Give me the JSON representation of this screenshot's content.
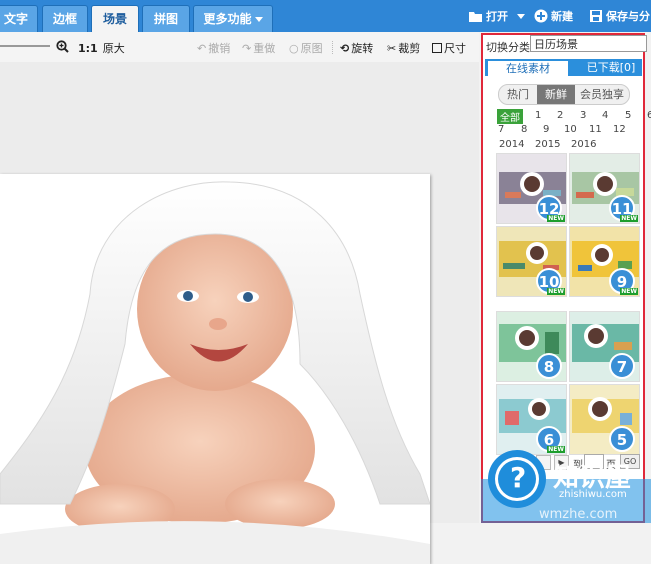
{
  "top_tabs": [
    {
      "label": "文字",
      "active": false
    },
    {
      "label": "边框",
      "active": false
    },
    {
      "label": "场景",
      "active": true
    },
    {
      "label": "拼图",
      "active": false
    },
    {
      "label": "更多功能",
      "active": false
    }
  ],
  "top_actions": {
    "open": "打开",
    "new": "新建",
    "save": "保存与分"
  },
  "toolbar": {
    "ratio": "1:1",
    "original_size": "原大",
    "undo": "撤销",
    "redo": "重做",
    "original": "原图",
    "rotate": "旋转",
    "crop": "裁剪",
    "size": "尺寸"
  },
  "panel": {
    "category_label": "切换分类",
    "category_value": "日历场景",
    "tabs": {
      "online": "在线素材",
      "downloaded": "已下载[0]"
    },
    "filters": [
      "热门",
      "新鲜",
      "会员独享"
    ],
    "selected_filter": "新鲜",
    "all_label": "全部",
    "numbers_row1": [
      "1",
      "2",
      "3",
      "4",
      "5",
      "6"
    ],
    "numbers_row2": [
      "7",
      "8",
      "9",
      "10",
      "11",
      "12"
    ],
    "years": [
      "2014",
      "2015",
      "2016"
    ],
    "thumbnails": [
      {
        "num": "12",
        "badge": "NEW"
      },
      {
        "num": "11",
        "badge": "NEW"
      },
      {
        "num": "10",
        "badge": "NEW"
      },
      {
        "num": "9",
        "badge": "NEW"
      },
      {
        "num": "8",
        "badge": ""
      },
      {
        "num": "7",
        "badge": ""
      },
      {
        "num": "6",
        "badge": "NEW"
      },
      {
        "num": "5",
        "badge": ""
      }
    ],
    "pager": {
      "to": "到",
      "page": "页",
      "go": "GO"
    }
  },
  "watermark": {
    "name": "知识屋",
    "domain": "zhishiwu.com",
    "url": "wmzhe.com"
  },
  "colors": {
    "top_bar": "#2f86d6",
    "highlight_border": "#e0283a",
    "badge_green": "#1e9e2e"
  }
}
